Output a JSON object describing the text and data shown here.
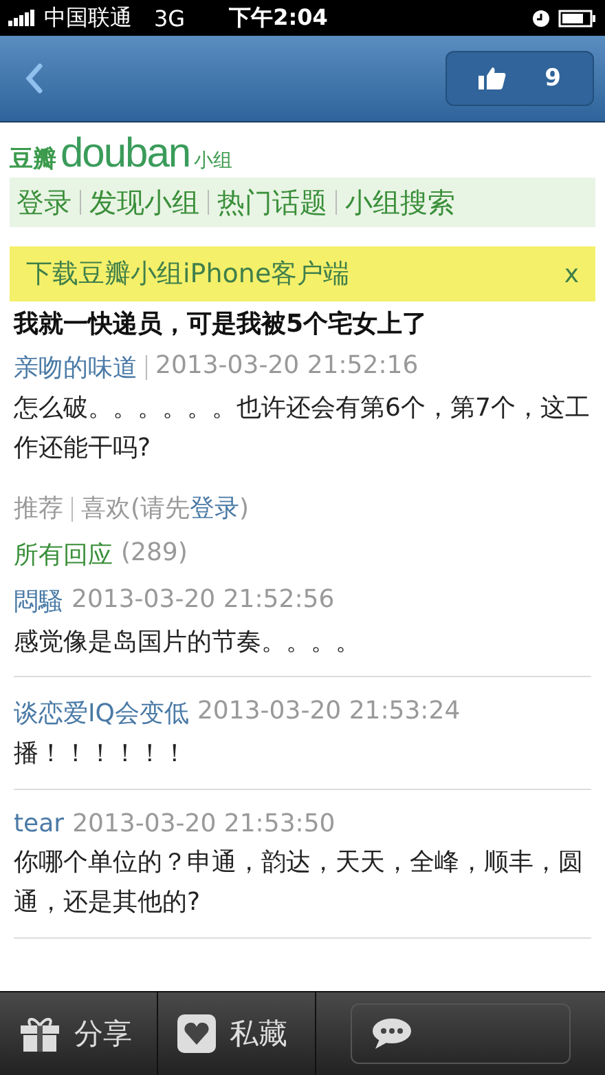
{
  "status_bar": {
    "carrier": "中国联通",
    "network": "3G",
    "time": "下午2:04"
  },
  "nav_bar": {
    "like_count": "9"
  },
  "logo": {
    "cn": "豆瓣",
    "en": "douban",
    "suffix": "小组"
  },
  "links": [
    "登录",
    "发现小组",
    "热门话题",
    "小组搜索"
  ],
  "banner": {
    "text": "下载豆瓣小组iPhone客户端",
    "close": "x"
  },
  "post": {
    "title": "我就一快递员，可是我被5个宅女上了",
    "author": "亲吻的味道",
    "time": "2013-03-20 21:52:16",
    "body": "怎么破。。。。。。也许还会有第6个，第7个，这工作还能干吗?"
  },
  "actions": {
    "recommend": "推荐",
    "like": "喜欢(请先",
    "login": "登录",
    "close_paren": ")"
  },
  "replies_header": {
    "label": "所有回应",
    "count": "(289)"
  },
  "replies": [
    {
      "author": "悶騷",
      "time": "2013-03-20 21:52:56",
      "body": "感觉像是岛国片的节奏。。。。"
    },
    {
      "author": "谈恋爱IQ会变低",
      "time": "2013-03-20 21:53:24",
      "body": "播！！！！！！"
    },
    {
      "author": "tear",
      "time": "2013-03-20 21:53:50",
      "body": "你哪个单位的？申通，韵达，天天，全峰，顺丰，圆通，还是其他的?"
    }
  ],
  "toolbar": [
    {
      "kind": "share",
      "label": "分享"
    },
    {
      "kind": "favorite",
      "label": "私藏"
    },
    {
      "kind": "comment"
    }
  ]
}
